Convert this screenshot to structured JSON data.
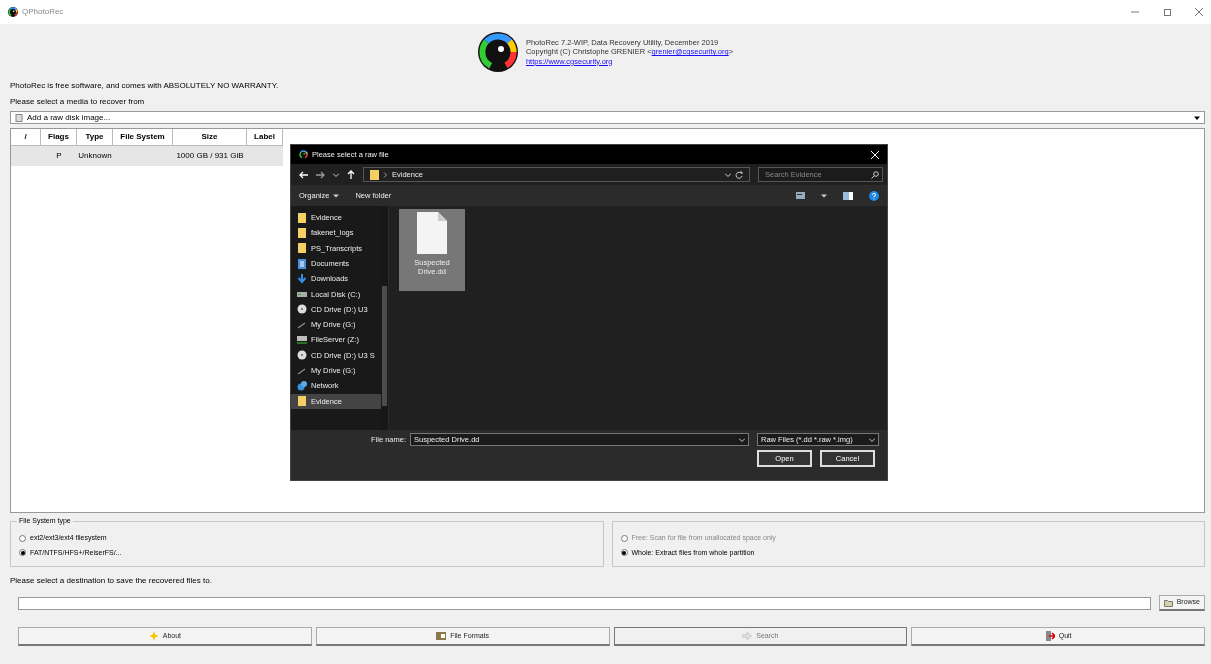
{
  "window": {
    "title": "QPhotoRec"
  },
  "about": {
    "line1": "PhotoRec 7.2-WIP, Data Recovery Utility, December 2019",
    "line2_prefix": "Copyright (C) Christophe GRENIER <",
    "email": "grenier@cgsecurity.org",
    "line2_suffix": ">",
    "website": "https://www.cgsecurity.org"
  },
  "notice": "PhotoRec is free software, and comes with ABSOLUTELY NO WARRANTY.",
  "media_prompt": "Please select a media to recover from",
  "media_combo": {
    "value": "Add a raw disk image..."
  },
  "table": {
    "columns": [
      "/",
      "Flags",
      "Type",
      "File System",
      "Size",
      "Label"
    ],
    "rows": [
      {
        "selected": true,
        "cells": [
          "",
          "P",
          "Unknown",
          "",
          "1000 GB / 931 GiB",
          ""
        ]
      }
    ]
  },
  "fs_group": {
    "title": "File System type",
    "options": [
      {
        "label": "ext2/ext3/ext4 filesystem",
        "selected": false,
        "disabled": false
      },
      {
        "label": "FAT/NTFS/HFS+/ReiserFS/...",
        "selected": true,
        "disabled": false
      }
    ]
  },
  "scan_group": {
    "options": [
      {
        "label": "Free: Scan for file from unallocated space only",
        "selected": false,
        "disabled": true
      },
      {
        "label": "Whole: Extract files from whole partition",
        "selected": true,
        "disabled": false
      }
    ]
  },
  "dest_prompt": "Please select a destination to save the recovered files to.",
  "browse_button": "Browse",
  "buttons": [
    {
      "label": "About",
      "kind": "about",
      "disabled": false
    },
    {
      "label": "File Formats",
      "kind": "formats",
      "disabled": false
    },
    {
      "label": "Search",
      "kind": "search",
      "disabled": true
    },
    {
      "label": "Quit",
      "kind": "quit",
      "disabled": false
    }
  ],
  "dialog": {
    "title": "Please select a raw file",
    "path": "Evidence",
    "search": {
      "placeholder": "Search Evidence"
    },
    "toolbar": [
      "Organize",
      "New folder"
    ],
    "nav": [
      {
        "label": "Evidence",
        "kind": "folder",
        "selected": false
      },
      {
        "label": "fakenet_logs",
        "kind": "folder",
        "selected": false
      },
      {
        "label": "PS_Transcripts",
        "kind": "folder",
        "selected": false
      },
      {
        "label": "Documents",
        "kind": "documents",
        "selected": false
      },
      {
        "label": "Downloads",
        "kind": "downloads",
        "selected": false
      },
      {
        "label": "Local Disk (C:)",
        "kind": "disk",
        "selected": false
      },
      {
        "label": "CD Drive (D:) U3",
        "kind": "cd",
        "selected": false
      },
      {
        "label": "My Drive (G:)",
        "kind": "cloud",
        "selected": false
      },
      {
        "label": "FileServer (Z:)",
        "kind": "server",
        "selected": false
      },
      {
        "label": "CD Drive (D:) U3 S",
        "kind": "cd",
        "selected": false
      },
      {
        "label": "My Drive (G:)",
        "kind": "cloud",
        "selected": false
      },
      {
        "label": "Network",
        "kind": "network",
        "selected": false
      },
      {
        "label": "Evidence",
        "kind": "folder",
        "selected": true
      }
    ],
    "files": [
      {
        "name": "Suspected Drive.dd",
        "selected": true
      }
    ],
    "file_name_label": "File name:",
    "file_name": "Suspected Drive.dd",
    "file_type": "Raw Files (*.dd *.raw *.img)",
    "open_button": "Open",
    "cancel_button": "Cancel"
  }
}
